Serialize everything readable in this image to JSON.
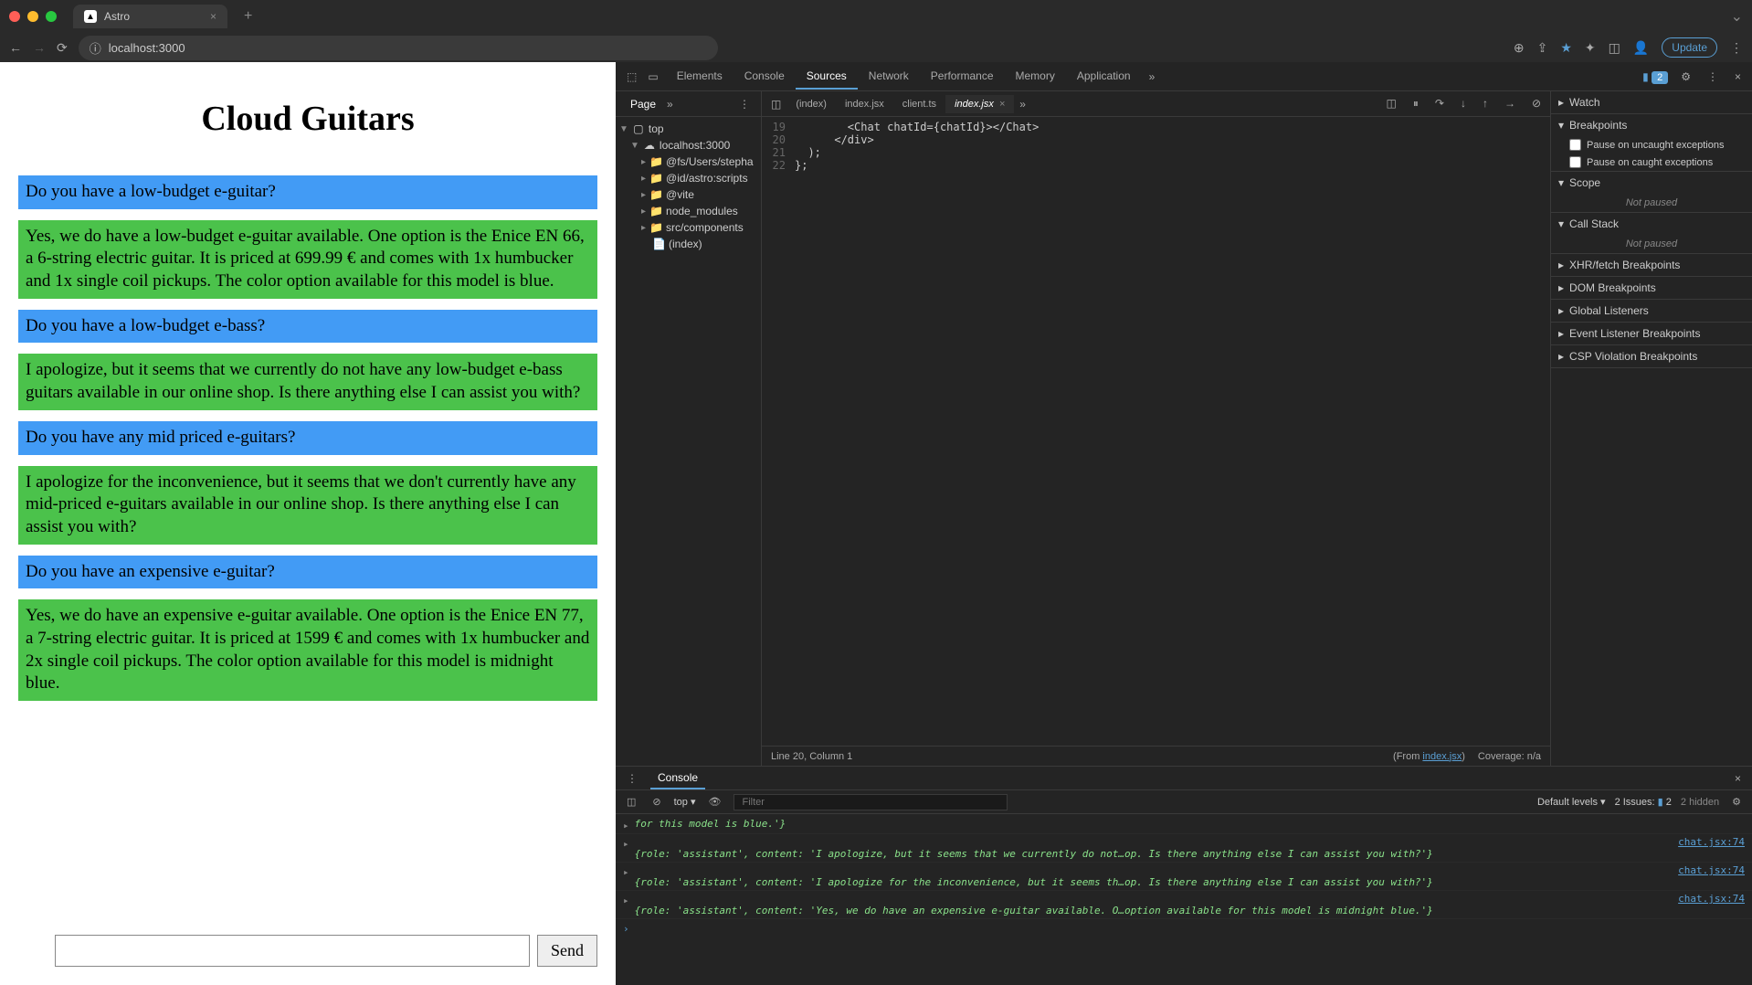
{
  "browser": {
    "tab_title": "Astro",
    "url": "localhost:3000",
    "update_label": "Update"
  },
  "page": {
    "title": "Cloud Guitars",
    "messages": [
      {
        "role": "user",
        "text": "Do you have a low-budget e-guitar?"
      },
      {
        "role": "assistant",
        "text": "Yes, we do have a low-budget e-guitar available. One option is the Enice EN 66, a 6-string electric guitar. It is priced at 699.99 € and comes with 1x humbucker and 1x single coil pickups. The color option available for this model is blue."
      },
      {
        "role": "user",
        "text": "Do you have a low-budget e-bass?"
      },
      {
        "role": "assistant",
        "text": "I apologize, but it seems that we currently do not have any low-budget e-bass guitars available in our online shop. Is there anything else I can assist you with?"
      },
      {
        "role": "user",
        "text": "Do you have any mid priced e-guitars?"
      },
      {
        "role": "assistant",
        "text": "I apologize for the inconvenience, but it seems that we don't currently have any mid-priced e-guitars available in our online shop. Is there anything else I can assist you with?"
      },
      {
        "role": "user",
        "text": "Do you have an expensive e-guitar?"
      },
      {
        "role": "assistant",
        "text": "Yes, we do have an expensive e-guitar available. One option is the Enice EN 77, a 7-string electric guitar. It is priced at 1599 € and comes with 1x humbucker and 2x single coil pickups. The color option available for this model is midnight blue."
      }
    ],
    "send_label": "Send"
  },
  "devtools": {
    "tabs": [
      "Elements",
      "Console",
      "Sources",
      "Network",
      "Performance",
      "Memory",
      "Application"
    ],
    "active_tab": "Sources",
    "issues_count": "2",
    "page_subtab": "Page",
    "tree": {
      "top": "top",
      "host": "localhost:3000",
      "folders": [
        "@fs/Users/stepha",
        "@id/astro:scripts",
        "@vite",
        "node_modules",
        "src/components"
      ],
      "file": "(index)"
    },
    "editor_tabs": [
      "(index)",
      "index.jsx",
      "client.ts",
      "index.jsx"
    ],
    "active_editor_tab": 3,
    "code_lines": [
      {
        "n": "19",
        "t": "        <Chat chatId={chatId}></Chat>"
      },
      {
        "n": "20",
        "t": "      </div>"
      },
      {
        "n": "21",
        "t": "  );"
      },
      {
        "n": "22",
        "t": "};"
      }
    ],
    "status": {
      "pos": "Line 20, Column 1",
      "from": "(From ",
      "from_link": "index.jsx",
      "from_end": ")",
      "coverage": "Coverage: n/a"
    },
    "right_pane": {
      "watch": "Watch",
      "breakpoints": "Breakpoints",
      "uncaught": "Pause on uncaught exceptions",
      "caught": "Pause on caught exceptions",
      "scope": "Scope",
      "not_paused": "Not paused",
      "callstack": "Call Stack",
      "xhr": "XHR/fetch Breakpoints",
      "dom": "DOM Breakpoints",
      "global": "Global Listeners",
      "event": "Event Listener Breakpoints",
      "csp": "CSP Violation Breakpoints"
    },
    "console": {
      "title": "Console",
      "context": "top",
      "filter_placeholder": "Filter",
      "levels": "Default levels",
      "issues": "2 Issues:",
      "issues_n": "2",
      "hidden": "2 hidden",
      "logs": [
        {
          "text": "for this model is blue.'}",
          "source": ""
        },
        {
          "text": "{role: 'assistant', content: 'I apologize, but it seems that we currently do not…op. Is there anything else I can assist you with?'}",
          "source": "chat.jsx:74"
        },
        {
          "text": "{role: 'assistant', content: 'I apologize for the inconvenience, but it seems th…op. Is there anything else I can assist you with?'}",
          "source": "chat.jsx:74"
        },
        {
          "text": "{role: 'assistant', content: 'Yes, we do have an expensive e-guitar available. O…option available for this model is midnight blue.'}",
          "source": "chat.jsx:74"
        }
      ]
    }
  }
}
